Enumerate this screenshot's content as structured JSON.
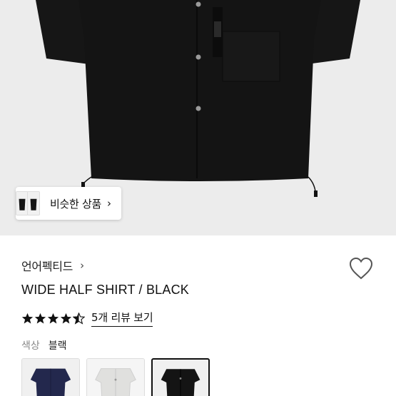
{
  "similar": {
    "label": "비슷한 상품",
    "arrow": "›"
  },
  "product": {
    "brand": "언어펙티드",
    "brand_arrow": "›",
    "name": "WIDE HALF SHIRT / BLACK",
    "rating": 4.5,
    "review_link": "5개 리뷰 보기"
  },
  "color": {
    "key": "색상",
    "value": "블랙"
  },
  "swatches": [
    {
      "color": "navy",
      "fill": "#23284d",
      "selected": false
    },
    {
      "color": "light-gray",
      "fill": "#e2e2e0",
      "selected": false
    },
    {
      "color": "black",
      "fill": "#141414",
      "selected": true
    }
  ],
  "colors": {
    "hero_bg": "#ececec",
    "shirt": "#141414",
    "star": "#111111"
  }
}
